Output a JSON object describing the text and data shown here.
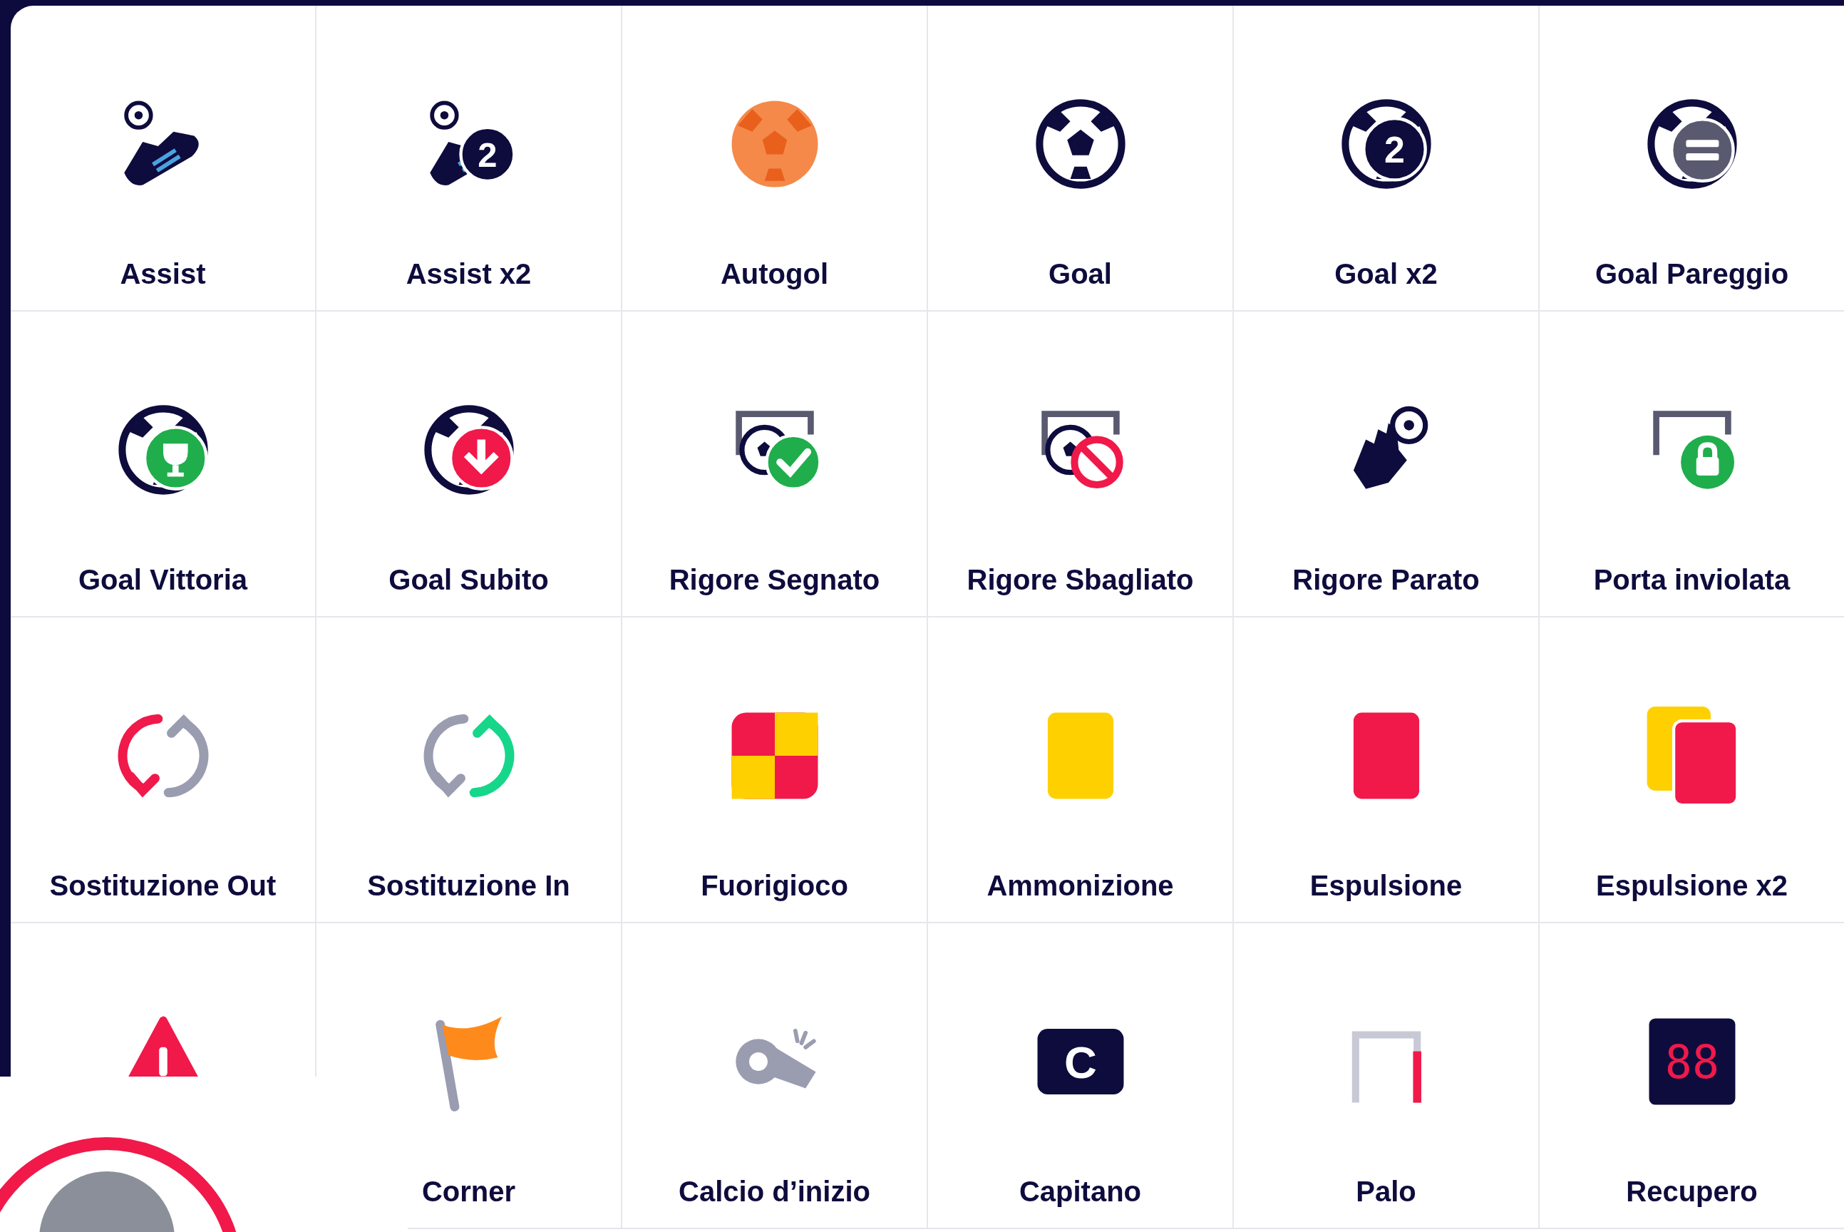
{
  "events": [
    {
      "kind": "boot",
      "label": "Assist"
    },
    {
      "kind": "boot2",
      "label": "Assist x2",
      "badge": "2"
    },
    {
      "kind": "ownball",
      "label": "Autogol"
    },
    {
      "kind": "ball",
      "label": "Goal"
    },
    {
      "kind": "ball2",
      "label": "Goal x2",
      "badge": "2"
    },
    {
      "kind": "ballequal",
      "label": "Goal Pareggio"
    },
    {
      "kind": "balltrophy",
      "label": "Goal Vittoria"
    },
    {
      "kind": "balldown",
      "label": "Goal Subito"
    },
    {
      "kind": "goalcheck",
      "label": "Rigore Segnato"
    },
    {
      "kind": "goalban",
      "label": "Rigore Sbagliato"
    },
    {
      "kind": "glove",
      "label": "Rigore Parato"
    },
    {
      "kind": "goallock",
      "label": "Porta inviolata"
    },
    {
      "kind": "subout",
      "label": "Sostituzione Out"
    },
    {
      "kind": "subin",
      "label": "Sostituzione In"
    },
    {
      "kind": "offside",
      "label": "Fuorigioco"
    },
    {
      "kind": "yellow",
      "label": "Ammonizione"
    },
    {
      "kind": "red",
      "label": "Espulsione"
    },
    {
      "kind": "red2",
      "label": "Espulsione x2"
    },
    {
      "kind": "warning"
    },
    {
      "kind": "flag",
      "label": "Corner"
    },
    {
      "kind": "whistle",
      "label": "Calcio d’inizio"
    },
    {
      "kind": "captain",
      "label": "Capitano",
      "badge": "C"
    },
    {
      "kind": "post",
      "label": "Palo"
    },
    {
      "kind": "board",
      "label": "Recupero",
      "badge": "88"
    }
  ]
}
